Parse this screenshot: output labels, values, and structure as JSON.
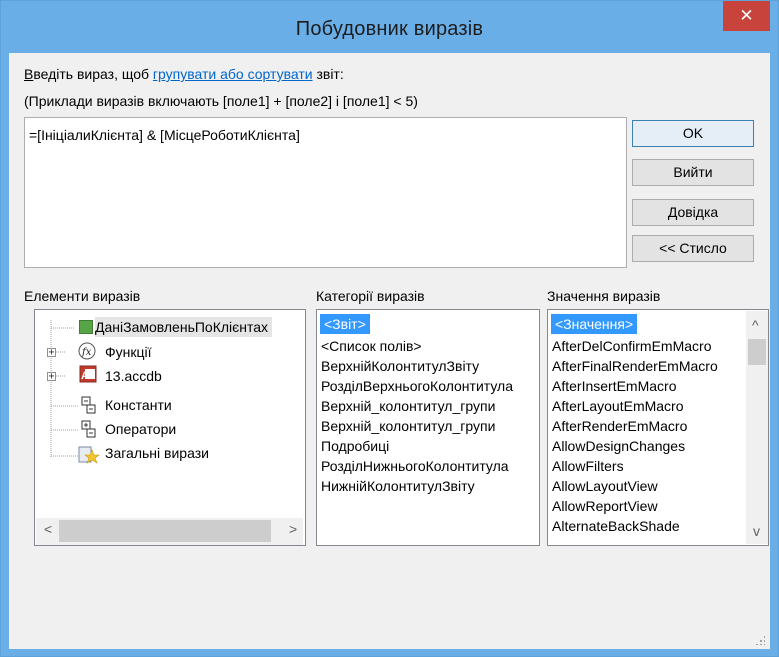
{
  "window": {
    "title": "Побудовник виразів",
    "close_symbol": "✕"
  },
  "instructions": {
    "line1_access_letter": "В",
    "line1_before": "ведіть вираз, щоб ",
    "line1_link": "групувати або сортувати",
    "line1_after": " звіт:",
    "line2": "(Приклади виразів включають [поле1] + [поле2] і [поле1] < 5)"
  },
  "expression": {
    "value": "=[ІніціалиКлієнта] & [МісцеРоботиКлієнта]"
  },
  "buttons": {
    "ok": "OK",
    "cancel": "Вийти",
    "help": "Довідка",
    "less": "<< Стисло"
  },
  "columns": {
    "elements_label": "Елементи виразів",
    "categories_label": "Категорії виразів",
    "values_label": "Значення виразів"
  },
  "tree": [
    {
      "label": "ДаніЗамовленьПоКлієнтах",
      "icon": "report-icon"
    },
    {
      "label": "Функції",
      "icon": "function-icon"
    },
    {
      "label": "13.accdb",
      "icon": "database-icon"
    },
    {
      "label": "Константи",
      "icon": "constants-icon"
    },
    {
      "label": "Оператори",
      "icon": "operators-icon"
    },
    {
      "label": "Загальні вирази",
      "icon": "common-expressions-icon"
    }
  ],
  "categories": [
    "<Звіт>",
    "<Список полів>",
    "ВерхнійКолонтитулЗвіту",
    "РозділВерхньогоКолонтитула",
    "Верхній_колонтитул_групи",
    "Верхній_колонтитул_групи",
    "Подробиці",
    "РозділНижньогоКолонтитула",
    "НижнійКолонтитулЗвіту"
  ],
  "values": [
    "<Значення>",
    "AfterDelConfirmEmMacro",
    "AfterFinalRenderEmMacro",
    "AfterInsertEmMacro",
    "AfterLayoutEmMacro",
    "AfterRenderEmMacro",
    "AllowDesignChanges",
    "AllowFilters",
    "AllowLayoutView",
    "AllowReportView",
    "AlternateBackShade"
  ],
  "scroll": {
    "left": "<",
    "right": ">",
    "up": "^",
    "down": "v"
  },
  "colors": {
    "titlebar": "#6aaee8",
    "close": "#c7433b",
    "selection": "#3399ff"
  }
}
